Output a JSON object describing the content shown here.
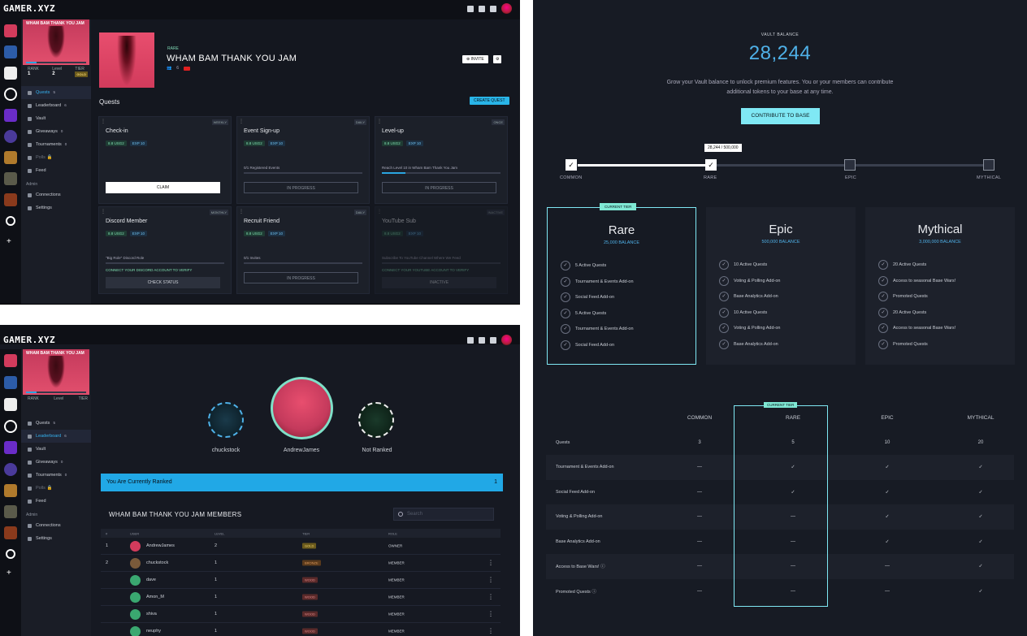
{
  "app": {
    "logo": "GAMER.XYZ"
  },
  "sidebar": {
    "banner_title": "WHAM BAM THANK YOU JAM",
    "stats": [
      {
        "label": "RANK",
        "value": "1"
      },
      {
        "label": "Level",
        "value": "2"
      },
      {
        "label": "TIER",
        "value": "GOLD"
      }
    ],
    "items": [
      {
        "label": "Quests",
        "count": "5"
      },
      {
        "label": "Leaderboard",
        "count": "6"
      },
      {
        "label": "Vault",
        "count": ""
      },
      {
        "label": "Giveaways",
        "count": "0"
      },
      {
        "label": "Tournaments",
        "count": "0"
      },
      {
        "label": "Polls",
        "count": ""
      },
      {
        "label": "Feed",
        "count": ""
      }
    ],
    "admin_label": "Admin",
    "admin_items": [
      {
        "label": "Connections"
      },
      {
        "label": "Settings"
      }
    ]
  },
  "base": {
    "tier_tag": "RARE",
    "title": "WHAM BAM THANK YOU JAM",
    "members_count": "6",
    "invite_label": "INVITE"
  },
  "quests": {
    "heading": "Quests",
    "create_label": "CREATE QUEST",
    "cards": [
      {
        "name": "Check-in",
        "freq": "WEEKLY",
        "reward": "8.8 USG2",
        "exp": "EXP 10",
        "progress_text": "",
        "progress": 0,
        "action": "CLAIM",
        "style": "white"
      },
      {
        "name": "Event Sign-up",
        "freq": "DAILY",
        "reward": "8.8 USG2",
        "exp": "EXP 10",
        "progress_text": "0/1 Registered Events",
        "progress": 0,
        "action": "IN PROGRESS",
        "style": "outline"
      },
      {
        "name": "Level-up",
        "freq": "ONCE",
        "reward": "8.8 USG2",
        "exp": "EXP 10",
        "progress_text": "Reach Level 10 in Wham Bam Thank You Jam",
        "progress": 0.2,
        "action": "IN PROGRESS",
        "style": "outline"
      },
      {
        "name": "Discord Member",
        "freq": "MONTHLY",
        "reward": "8.8 USG2",
        "exp": "EXP 10",
        "progress_text": "\"Big Role\" Discord Role",
        "progress": 0,
        "note": "CONNECT YOUR DISCORD ACCOUNT TO VERIFY",
        "action": "CHECK STATUS",
        "style": "grey"
      },
      {
        "name": "Recruit Friend",
        "freq": "DAILY",
        "reward": "8.8 USG2",
        "exp": "EXP 10",
        "progress_text": "0/1 Invites",
        "progress": 0,
        "action": "IN PROGRESS",
        "style": "outline"
      },
      {
        "name": "YouTube Sub",
        "freq": "INACTIVE",
        "reward": "8.8 USG2",
        "exp": "EXP 10",
        "progress_text": "Subscribe To YouTube Channel Where We Feed",
        "progress": 0,
        "note": "CONNECT YOUR YOUTUBE ACCOUNT TO VERIFY",
        "action": "INACTIVE",
        "style": "grey"
      }
    ]
  },
  "leaderboard": {
    "podium": [
      {
        "name": "chuckstock",
        "rank": "2"
      },
      {
        "name": "AndrewJames",
        "rank": ""
      },
      {
        "name": "Not Ranked",
        "rank": "3"
      }
    ],
    "ranked_text": "You Are Currently Ranked",
    "ranked_value": "1",
    "members_heading": "WHAM BAM THANK YOU JAM MEMBERS",
    "search_placeholder": "Search",
    "columns": [
      "#",
      "USER",
      "LEVEL",
      "TIER",
      "ROLE"
    ],
    "rows": [
      {
        "rank": "1",
        "user": "AndrewJames",
        "level": "2",
        "tier": "GOLD",
        "role": "OWNER"
      },
      {
        "rank": "2",
        "user": "chuckstock",
        "level": "1",
        "tier": "BRONZE",
        "role": "MEMBER"
      },
      {
        "rank": "",
        "user": "dave",
        "level": "1",
        "tier": "WOOD",
        "role": "MEMBER"
      },
      {
        "rank": "",
        "user": "Amon_M",
        "level": "1",
        "tier": "WOOD",
        "role": "MEMBER"
      },
      {
        "rank": "",
        "user": "shiva",
        "level": "1",
        "tier": "WOOD",
        "role": "MEMBER"
      },
      {
        "rank": "",
        "user": "neuphy",
        "level": "1",
        "tier": "WOOD",
        "role": "MEMBER"
      }
    ]
  },
  "vault": {
    "label": "VAULT BALANCE",
    "balance": "28,244",
    "description": "Grow your Vault balance to unlock premium features. You or your members can contribute additional tokens to your base at any time.",
    "contribute_label": "CONTRIBUTE TO BASE",
    "progress_tooltip": "28,244 / 500,000",
    "progress_fraction": 0.056,
    "steps": [
      {
        "label": "COMMON",
        "checked": true
      },
      {
        "label": "RARE",
        "checked": true
      },
      {
        "label": "EPIC",
        "checked": false
      },
      {
        "label": "MYTHICAL",
        "checked": false
      }
    ],
    "current_tier_label": "CURRENT TIER",
    "tiers": [
      {
        "name": "Rare",
        "balance": "25,000 BALANCE",
        "features": [
          "5 Active Quests",
          "Tournament & Events Add-on",
          "Social Feed Add-on",
          "5 Active Quests",
          "Tournament & Events Add-on",
          "Social Feed Add-on"
        ]
      },
      {
        "name": "Epic",
        "balance": "500,000 BALANCE",
        "features": [
          "10 Active Quests",
          "Voting & Polling Add-on",
          "Base Analytics Add-on",
          "10 Active Quests",
          "Voting & Polling Add-on",
          "Base Analytics Add-on"
        ]
      },
      {
        "name": "Mythical",
        "balance": "3,000,000 BALANCE",
        "features": [
          "20 Active Quests",
          "Access to seasonal Base Wars!",
          "Promoted Quests",
          "20 Active Quests",
          "Access to seasonal Base Wars!",
          "Promoted Quests"
        ]
      }
    ],
    "compare_columns": [
      "COMMON",
      "RARE",
      "EPIC",
      "MYTHICAL"
    ],
    "compare_rows": [
      {
        "label": "Quests",
        "values": [
          "3",
          "5",
          "10",
          "20"
        ]
      },
      {
        "label": "Tournament & Events Add-on",
        "values": [
          "—",
          "✓",
          "✓",
          "✓"
        ]
      },
      {
        "label": "Social Feed Add-on",
        "values": [
          "—",
          "✓",
          "✓",
          "✓"
        ]
      },
      {
        "label": "Voting & Polling Add-on",
        "values": [
          "—",
          "—",
          "✓",
          "✓"
        ]
      },
      {
        "label": "Base Analytics Add-on",
        "values": [
          "—",
          "—",
          "✓",
          "✓"
        ]
      },
      {
        "label": "Access to Base Wars! ⓘ",
        "values": [
          "—",
          "—",
          "—",
          "✓"
        ]
      },
      {
        "label": "Promoted Quests ⓘ",
        "values": [
          "—",
          "—",
          "—",
          "✓"
        ]
      }
    ]
  },
  "colors": {
    "accent": "#29b5e8",
    "mint": "#7fe8f4",
    "bg": "#14171f"
  }
}
